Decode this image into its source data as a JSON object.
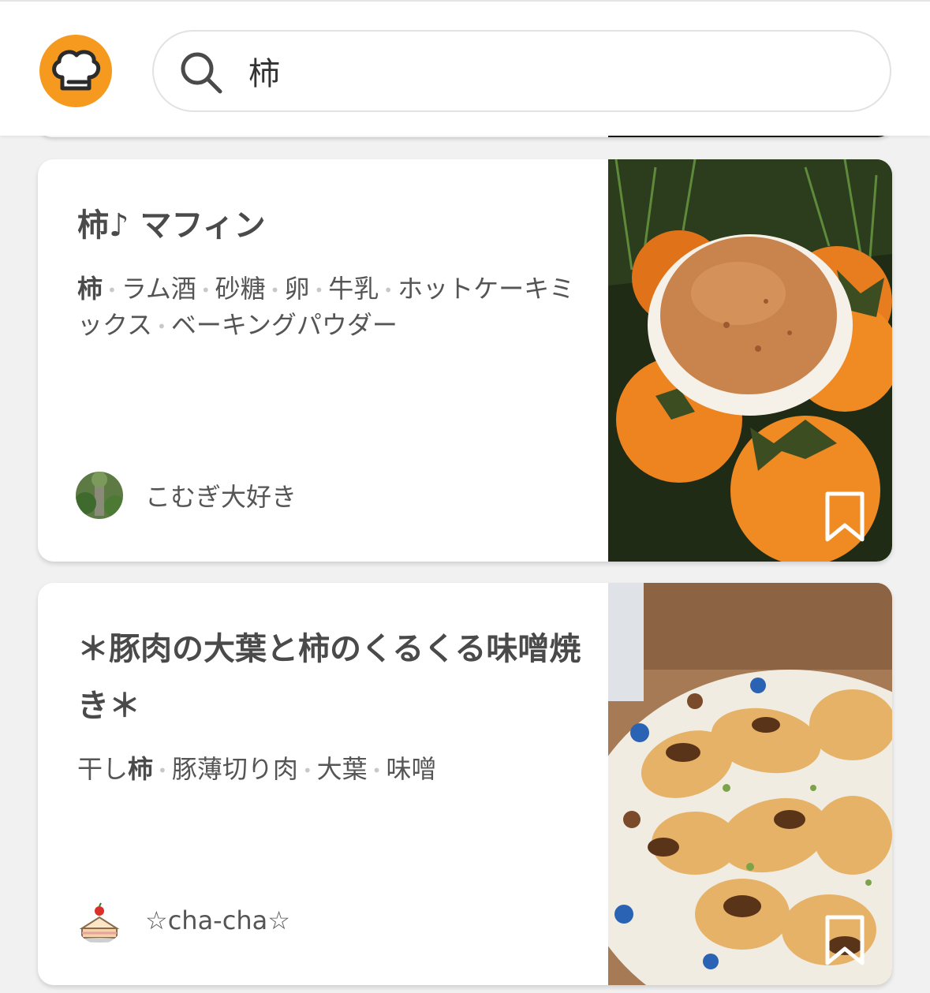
{
  "header": {
    "logo_icon": "chef-hat-icon",
    "brand_color": "#f59a1e",
    "search": {
      "value": "柿",
      "icon": "search-icon"
    }
  },
  "recipes": [
    {
      "title": "柿♪ マフィン",
      "ingredients": [
        {
          "text": "柿",
          "highlight": true
        },
        {
          "text": "ラム酒",
          "highlight": false
        },
        {
          "text": "砂糖",
          "highlight": false
        },
        {
          "text": "卵",
          "highlight": false
        },
        {
          "text": "牛乳",
          "highlight": false
        },
        {
          "text": "ホットケーキミックス",
          "highlight": false
        },
        {
          "text": "ベーキングパウダー",
          "highlight": false
        }
      ],
      "author": "こむぎ大好き",
      "bookmark_icon": "bookmark-icon"
    },
    {
      "title": "＊豚肉の大葉と柿のくるくる味噌焼き＊",
      "ingredients_prefix": "干し",
      "ingredients": [
        {
          "text": "柿",
          "highlight": true
        },
        {
          "text": "豚薄切り肉",
          "highlight": false
        },
        {
          "text": "大葉",
          "highlight": false
        },
        {
          "text": "味噌",
          "highlight": false
        }
      ],
      "author": "☆cha-cha☆",
      "bookmark_icon": "bookmark-icon"
    }
  ]
}
